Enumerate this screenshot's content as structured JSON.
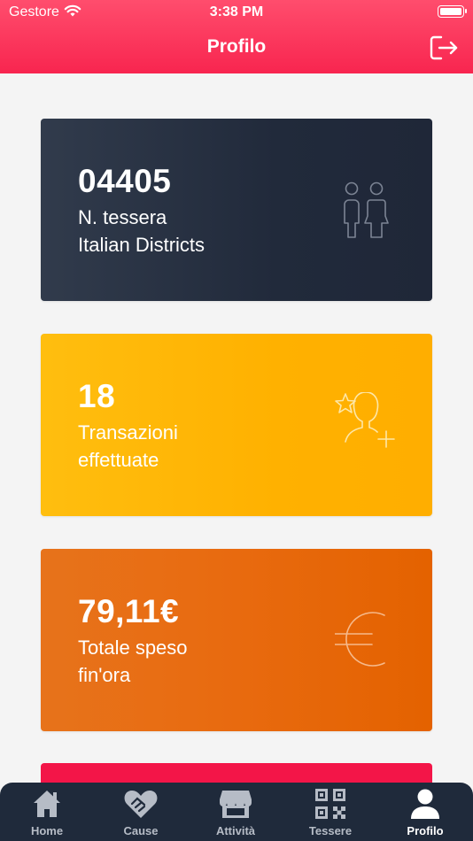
{
  "status_bar": {
    "carrier": "Gestore",
    "time": "3:38 PM"
  },
  "header": {
    "title": "Profilo"
  },
  "cards": [
    {
      "value": "04405",
      "line1": "N. tessera",
      "line2": "Italian Districts",
      "icon": "family-icon"
    },
    {
      "value": "18",
      "line1": "Transazioni",
      "line2": "effettuate",
      "icon": "star-person-add-icon"
    },
    {
      "value": "79,11€",
      "line1": "Totale speso",
      "line2": "fin'ora",
      "icon": "euro-icon"
    }
  ],
  "tabbar": {
    "items": [
      {
        "label": "Home",
        "icon": "home-icon"
      },
      {
        "label": "Cause",
        "icon": "handshake-heart-icon"
      },
      {
        "label": "Attività",
        "icon": "store-icon"
      },
      {
        "label": "Tessere",
        "icon": "qr-code-icon"
      },
      {
        "label": "Profilo",
        "icon": "person-icon",
        "active": true
      }
    ]
  },
  "colors": {
    "header": "#f8254f",
    "card_dark": "#212a3b",
    "card_yellow": "#ffb100",
    "card_orange": "#e86a0f",
    "card_red": "#f31548",
    "tabbar": "#1f2a3b"
  }
}
